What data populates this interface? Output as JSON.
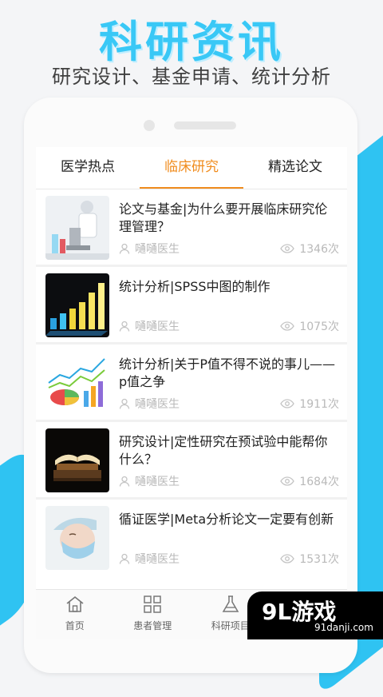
{
  "hero": {
    "title": "科研资讯",
    "subtitle": "研究设计、基金申请、统计分析"
  },
  "tabs": [
    {
      "label": "医学热点",
      "active": false
    },
    {
      "label": "临床研究",
      "active": true
    },
    {
      "label": "精选论文",
      "active": false
    }
  ],
  "articles": [
    {
      "title": "论文与基金|为什么要开展临床研究伦理管理？",
      "author": "嗵嗵医生",
      "views": "1346次",
      "thumb": "lab-microscope-image"
    },
    {
      "title": "统计分析|SPSS中图的制作",
      "author": "嗵嗵医生",
      "views": "1075次",
      "thumb": "bar-chart-3d-image"
    },
    {
      "title": "统计分析|关于P值不得不说的事儿——p值之争",
      "author": "嗵嗵医生",
      "views": "1911次",
      "thumb": "pie-line-chart-image"
    },
    {
      "title": "研究设计|定性研究在预试验中能帮你什么？",
      "author": "嗵嗵医生",
      "views": "1684次",
      "thumb": "open-book-image"
    },
    {
      "title": "循证医学|Meta分析论文一定要有创新",
      "author": "嗵嗵医生",
      "views": "1531次",
      "thumb": "surgeon-mask-image"
    }
  ],
  "bottom_nav": [
    {
      "label": "首页",
      "icon": "home-icon"
    },
    {
      "label": "患者管理",
      "icon": "grid-icon"
    },
    {
      "label": "科研项目",
      "icon": "flask-icon"
    },
    {
      "label": "",
      "icon": "profile-icon"
    }
  ],
  "watermark": {
    "logo": "9L游戏",
    "url": "91danji.com"
  },
  "colors": {
    "accent": "#f08c1e",
    "hero_blue": "#39c8f6"
  }
}
